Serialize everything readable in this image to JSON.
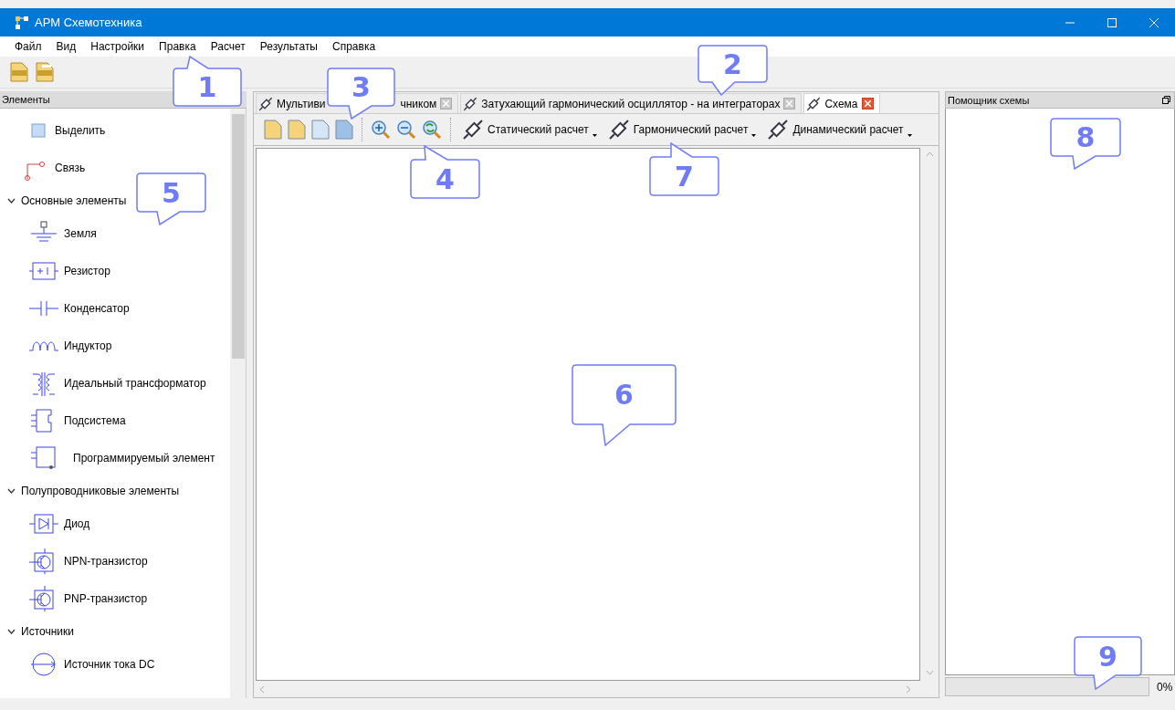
{
  "window": {
    "title": "АРМ Схемотехника"
  },
  "menu": [
    "Файл",
    "Вид",
    "Настройки",
    "Правка",
    "Расчет",
    "Результаты",
    "Справка"
  ],
  "elements_panel": {
    "title": "Элементы",
    "items": [
      {
        "label": "Выделить"
      },
      {
        "label": "Связь"
      },
      {
        "label": "Основные элементы",
        "expanded": true,
        "children": [
          {
            "label": "Земля"
          },
          {
            "label": "Резистор"
          },
          {
            "label": "Конденсатор"
          },
          {
            "label": "Индуктор"
          },
          {
            "label": "Идеальный трансформатор"
          },
          {
            "label": "Подсистема"
          },
          {
            "label": "Программируемый элемент"
          }
        ]
      },
      {
        "label": "Полупроводниковые элементы",
        "expanded": true,
        "children": [
          {
            "label": "Диод"
          },
          {
            "label": "NPN-транзистор"
          },
          {
            "label": "PNP-транзистор"
          }
        ]
      },
      {
        "label": "Источники",
        "expanded": true,
        "children": [
          {
            "label": "Источник тока DC"
          }
        ]
      }
    ]
  },
  "tabs": [
    {
      "label": "Мультиви",
      "label_end": "чником",
      "selected": false
    },
    {
      "label": "Затухающий гармонический осциллятор - на интеграторах",
      "selected": false
    },
    {
      "label": "Схема",
      "selected": true
    }
  ],
  "analysis_buttons": [
    "Статический расчет",
    "Гармонический расчет",
    "Динамический расчет"
  ],
  "helper_panel": {
    "title": "Помощник схемы"
  },
  "progress": {
    "level": 0,
    "reading": "0%"
  },
  "callouts": [
    {
      "label": "1"
    },
    {
      "label": "2"
    },
    {
      "label": "3"
    },
    {
      "label": "4"
    },
    {
      "label": "5"
    },
    {
      "label": "6"
    },
    {
      "label": "7"
    },
    {
      "label": "8"
    },
    {
      "label": "9"
    }
  ]
}
